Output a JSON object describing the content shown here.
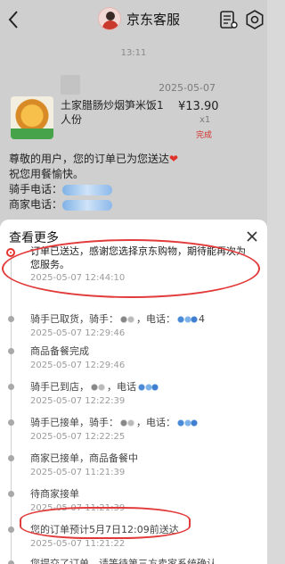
{
  "header": {
    "title": "京东客服",
    "back_icon": "back-arrow-icon",
    "receipt_icon": "receipt-icon",
    "settings_icon": "settings-icon"
  },
  "chat": {
    "time": "13:11",
    "order_card": {
      "date": "2025-05-07",
      "food_name": "土家腊肠炒烟笋米饭1人份",
      "price": "¥13.90",
      "quantity": "x1",
      "status": "完成"
    },
    "message_lines": [
      "尊敬的用户，您的订单已为您送达",
      "祝您用餐愉快。",
      "骑手电话：",
      "商家电话："
    ]
  },
  "sheet": {
    "title": "查看更多",
    "close_icon": "close-icon",
    "events": [
      {
        "text": "订单已送达，感谢您选择京东购物，期待能再次为您服务。",
        "time": "2025-05-07 12:44:10"
      },
      {
        "text_a": "骑手已取货，骑手：",
        "text_b": "，电话：",
        "text_c": "4",
        "time": "2025-05-07 12:29:46"
      },
      {
        "text": "商品备餐完成",
        "time": "2025-05-07 12:29:46"
      },
      {
        "text_a": "骑手已到店，",
        "text_b": "，电话",
        "time": "2025-05-07 12:22:39"
      },
      {
        "text_a": "骑手已接单，骑手：",
        "text_b": "，电话：",
        "time": "2025-05-07 12:22:25"
      },
      {
        "text": "商家已接单，商品备餐中",
        "time": "2025-05-07 11:21:39"
      },
      {
        "text": "待商家接单",
        "time": "2025-05-07 11:21:39"
      },
      {
        "text": "您的订单预计5月7日12:09前送达",
        "time": "2025-05-07 11:21:22"
      },
      {
        "text": "您提交了订单，请等待第三方卖家系统确认"
      }
    ]
  },
  "colors": {
    "accent_red": "#e3332d",
    "highlight_red": "#e23b3b",
    "sheet_bg": "#ffffff",
    "overlay_bg": "#cfcfcf"
  }
}
